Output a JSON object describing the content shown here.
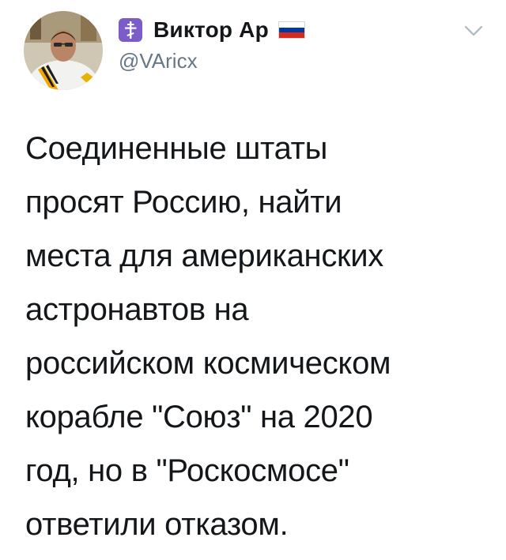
{
  "user": {
    "display_name": "Виктор Ар",
    "handle": "@VAricx",
    "badge_icon": "orthodox-cross-icon",
    "flag_icon": "russia-flag-icon",
    "flag_colors": [
      "#ffffff",
      "#0039a6",
      "#d52b1e"
    ],
    "badge_color": "#7c5cc8"
  },
  "menu": {
    "caret_icon": "chevron-down-icon"
  },
  "tweet": {
    "lines": [
      "Соединенные штаты",
      "просят Россию, найти",
      "места для американских",
      "астронавтов на",
      "российском космическом",
      "корабле \"Союз\" на 2020",
      "год, но в \"Роскосмосе\"",
      "ответили отказом."
    ]
  }
}
